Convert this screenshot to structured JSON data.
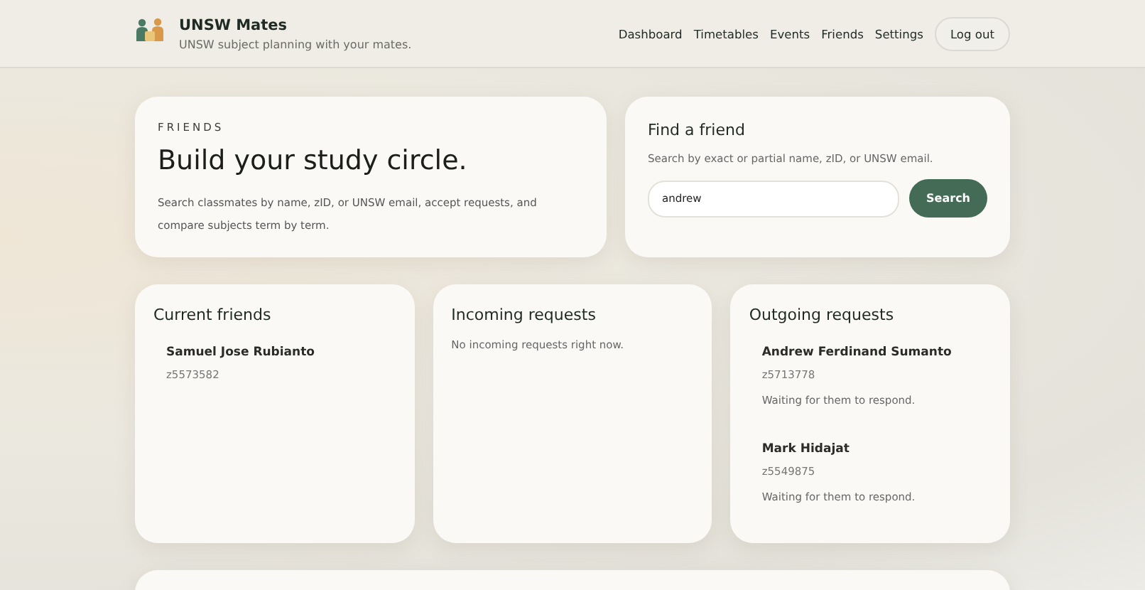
{
  "header": {
    "title": "UNSW Mates",
    "subtitle": "UNSW subject planning with your mates.",
    "nav": [
      "Dashboard",
      "Timetables",
      "Events",
      "Friends",
      "Settings"
    ],
    "logout": "Log out"
  },
  "hero": {
    "eyebrow": "FRIENDS",
    "heading": "Build your study circle.",
    "text": "Search classmates by name, zID, or UNSW email, accept requests, and compare subjects term by term."
  },
  "find": {
    "title": "Find a friend",
    "hint": "Search by exact or partial name, zID, or UNSW email.",
    "value": "andrew",
    "button": "Search"
  },
  "panels": [
    {
      "title": "Current friends",
      "people": [
        {
          "name": "Samuel Jose Rubianto",
          "zid": "z5573582"
        }
      ]
    },
    {
      "title": "Incoming requests",
      "empty": "No incoming requests right now."
    },
    {
      "title": "Outgoing requests",
      "people": [
        {
          "name": "Andrew Ferdinand Sumanto",
          "zid": "z5713778",
          "status": "Waiting for them to respond."
        },
        {
          "name": "Mark Hidajat",
          "zid": "z5549875",
          "status": "Waiting for them to respond."
        }
      ]
    }
  ]
}
